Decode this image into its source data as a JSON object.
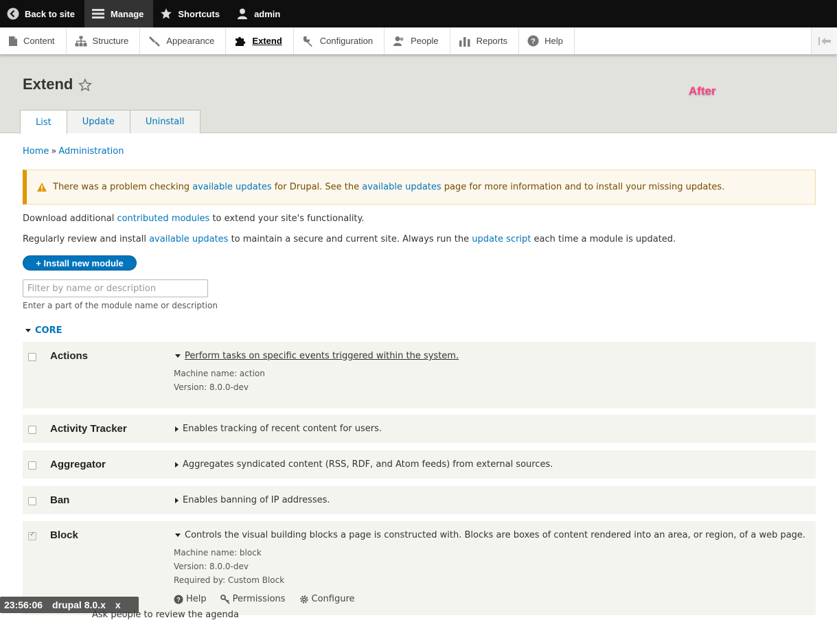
{
  "toolbar": {
    "back_to_site": "Back to site",
    "manage": "Manage",
    "shortcuts": "Shortcuts",
    "user": "admin"
  },
  "tray": {
    "items": [
      "Content",
      "Structure",
      "Appearance",
      "Extend",
      "Configuration",
      "People",
      "Reports",
      "Help"
    ],
    "active": "Extend"
  },
  "header": {
    "title": "Extend",
    "annotation": "After",
    "tabs": [
      "List",
      "Update",
      "Uninstall"
    ],
    "active_tab": "List"
  },
  "breadcrumb": {
    "home": "Home",
    "separator": "»",
    "admin": "Administration"
  },
  "warning": {
    "t1": "There was a problem checking ",
    "link1": "available updates",
    "t2": " for Drupal. See the ",
    "link2": "available updates",
    "t3": " page for more information and to install your missing updates."
  },
  "intro": {
    "p1_t1": "Download additional ",
    "p1_link": "contributed modules",
    "p1_t2": " to extend your site's functionality.",
    "p2_t1": "Regularly review and install ",
    "p2_link1": "available updates",
    "p2_t2": " to maintain a secure and current site. Always run the ",
    "p2_link2": "update script",
    "p2_t3": " each time a module is updated."
  },
  "install_button": "+ Install new module",
  "filter": {
    "placeholder": "Filter by name or description",
    "description": "Enter a part of the module name or description"
  },
  "package": "CORE",
  "modules": [
    {
      "name": "Actions",
      "description": "Perform tasks on specific events triggered within the system.",
      "machine_name": "Machine name: action",
      "version": "Version: 8.0.0-dev",
      "checked": false
    },
    {
      "name": "Activity Tracker",
      "description": "Enables tracking of recent content for users.",
      "checked": false
    },
    {
      "name": "Aggregator",
      "description": "Aggregates syndicated content (RSS, RDF, and Atom feeds) from external sources.",
      "checked": false
    },
    {
      "name": "Ban",
      "description": "Enables banning of IP addresses.",
      "checked": false
    },
    {
      "name": "Block",
      "description": "Controls the visual building blocks a page is constructed with. Blocks are boxes of content rendered into an area, or region, of a web page.",
      "machine_name": "Machine name: block",
      "version": "Version: 8.0.0-dev",
      "required_by": "Required by: Custom Block",
      "checked": true,
      "links": [
        "Help",
        "Permissions",
        "Configure"
      ]
    }
  ],
  "overlay": {
    "time": "23:56:06",
    "label": "drupal 8.0.x",
    "close": "x"
  },
  "bottom_text": "Ask people to review the agenda"
}
